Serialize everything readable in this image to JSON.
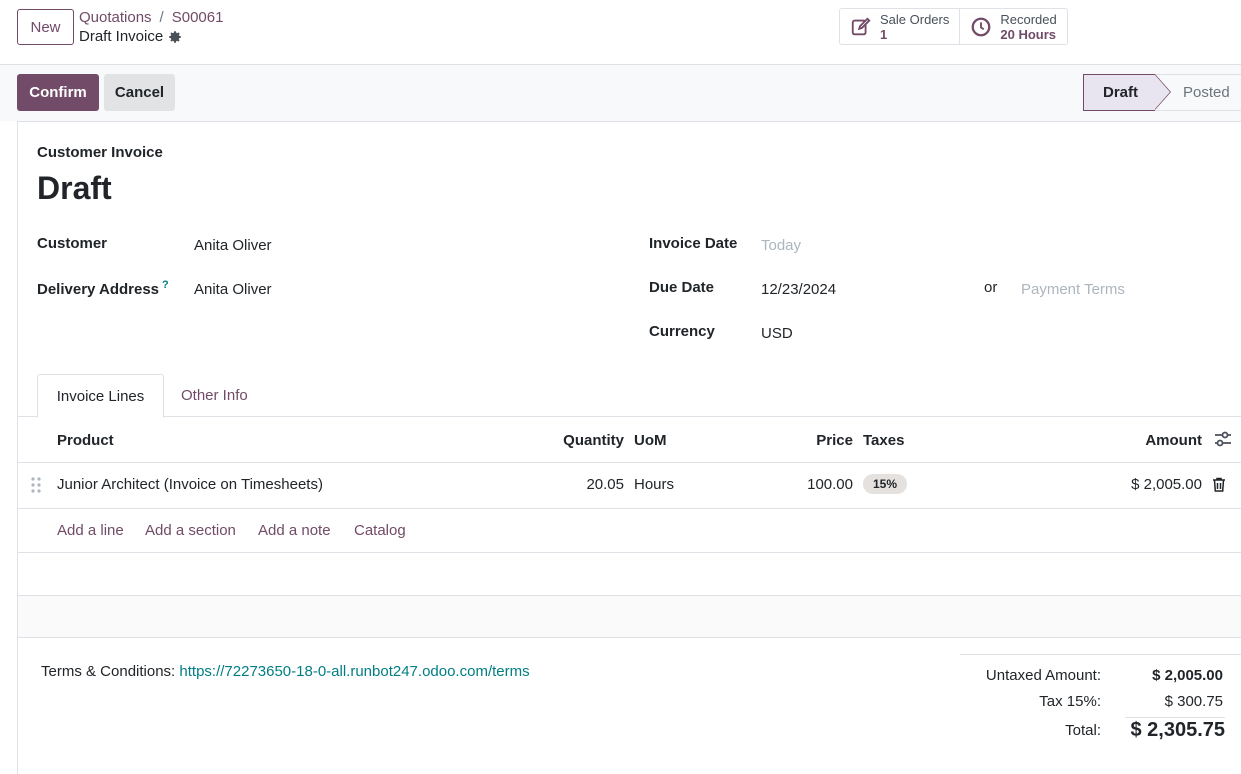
{
  "control_panel": {
    "new_label": "New",
    "breadcrumb": [
      "Quotations",
      "S00061"
    ],
    "record_title": "Draft Invoice",
    "smart_buttons": [
      {
        "label": "Sale Orders",
        "value": "1",
        "icon": "edit-icon"
      },
      {
        "label": "Recorded",
        "value": "20 Hours",
        "icon": "clock-icon"
      }
    ]
  },
  "actions": {
    "confirm_label": "Confirm",
    "cancel_label": "Cancel"
  },
  "status": {
    "stages": [
      "Draft",
      "Posted"
    ],
    "current": "Draft"
  },
  "invoice": {
    "type": "Customer Invoice",
    "name": "Draft",
    "customer_label": "Customer",
    "customer": "Anita Oliver",
    "delivery_label": "Delivery Address",
    "delivery_help": "?",
    "delivery": "Anita Oliver",
    "invoice_date_label": "Invoice Date",
    "invoice_date_placeholder": "Today",
    "due_date_label": "Due Date",
    "due_date": "12/23/2024",
    "or_label": "or",
    "payment_terms_placeholder": "Payment Terms",
    "currency_label": "Currency",
    "currency": "USD"
  },
  "tabs": [
    "Invoice Lines",
    "Other Info"
  ],
  "table": {
    "columns": {
      "product": "Product",
      "quantity": "Quantity",
      "uom": "UoM",
      "price": "Price",
      "taxes": "Taxes",
      "amount": "Amount"
    },
    "rows": [
      {
        "product": "Junior Architect (Invoice on Timesheets)",
        "quantity": "20.05",
        "uom": "Hours",
        "price": "100.00",
        "taxes": "15%",
        "amount": "$ 2,005.00"
      }
    ],
    "add_links": [
      "Add a line",
      "Add a section",
      "Add a note",
      "Catalog"
    ]
  },
  "footer": {
    "terms_label": "Terms & Conditions:",
    "terms_url": "https://72273650-18-0-all.runbot247.odoo.com/terms",
    "untaxed_label": "Untaxed Amount:",
    "untaxed_value": "$ 2,005.00",
    "tax_label": "Tax 15%:",
    "tax_value": "$ 300.75",
    "total_label": "Total:",
    "total_value": "$ 2,305.75"
  },
  "colors": {
    "brand": "#714b67",
    "link": "#017e84",
    "border": "#dee2e6"
  }
}
